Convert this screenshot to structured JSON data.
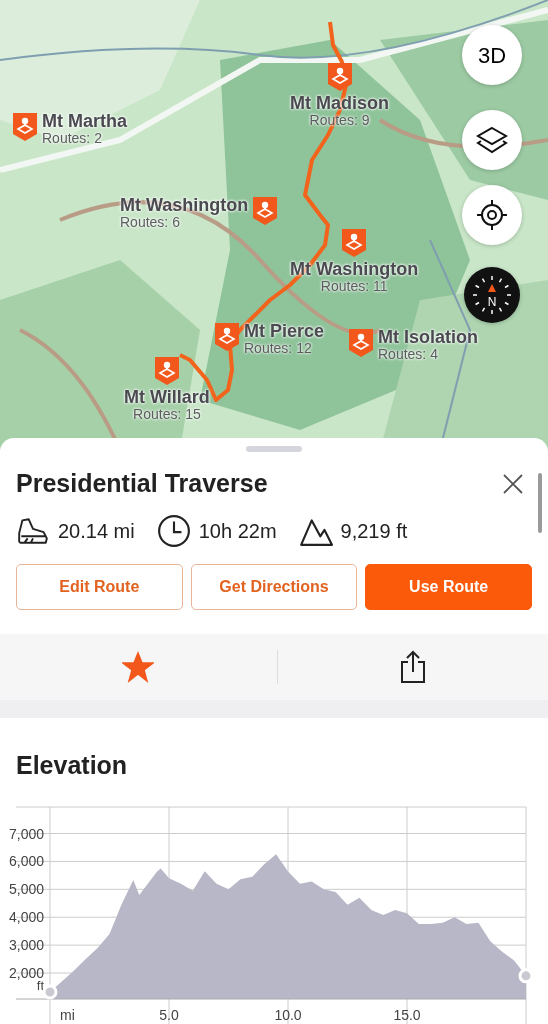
{
  "map": {
    "kind": "picture",
    "controls": [
      {
        "kind": "perspective",
        "label": "3D"
      },
      {
        "kind": "layers"
      },
      {
        "kind": "locate"
      },
      {
        "kind": "compass",
        "label": "N"
      }
    ],
    "peaks": [
      {
        "name": "Mt Martha",
        "routes": "Routes: 2"
      },
      {
        "name": "Mt Madison",
        "routes": "Routes: 9"
      },
      {
        "name": "Mt Washington",
        "routes": "Routes: 6"
      },
      {
        "name": "Mt Washington",
        "routes": "Routes: 11"
      },
      {
        "name": "Mt Pierce",
        "routes": "Routes: 12"
      },
      {
        "name": "Mt Isolation",
        "routes": "Routes: 4"
      },
      {
        "name": "Mt Willard",
        "routes": "Routes: 15"
      }
    ]
  },
  "route": {
    "title": "Presidential Traverse",
    "stats": [
      {
        "kind": "distance",
        "value": "20.14 mi"
      },
      {
        "kind": "time",
        "value": "10h 22m"
      },
      {
        "kind": "elevation",
        "value": "9,219 ft"
      }
    ],
    "buttons": [
      {
        "label": "Edit Route",
        "kind": "outline"
      },
      {
        "label": "Get Directions",
        "kind": "outline"
      },
      {
        "label": "Use Route",
        "kind": "filled"
      }
    ],
    "favorite": {
      "selected": true
    }
  },
  "elevation": {
    "chart_data": {
      "type": "area",
      "title": "Elevation",
      "xlabel": "mi",
      "ylabel": "ft",
      "x": [
        0,
        1,
        1.5,
        2,
        2.5,
        3,
        3.5,
        3.75,
        4.5,
        4.65,
        5,
        5.5,
        6,
        6.5,
        7,
        7.5,
        8,
        8.5,
        9,
        9.5,
        10,
        10.5,
        11,
        11.5,
        12,
        12.5,
        13,
        13.5,
        14,
        14.5,
        15,
        15.5,
        16,
        16.5,
        17,
        17.5,
        18,
        18.5,
        19,
        19.5,
        20
      ],
      "series": [
        {
          "color": "#b8b7c7",
          "values": [
            1320,
            2080,
            2500,
            2900,
            3400,
            4450,
            5330,
            4800,
            5640,
            5750,
            5400,
            5200,
            4950,
            5650,
            5200,
            5000,
            5360,
            5450,
            5900,
            6260,
            5640,
            5200,
            5280,
            5000,
            4900,
            4450,
            4700,
            4260,
            4080,
            4260,
            4140,
            3760,
            3760,
            3800,
            4000,
            3760,
            3800,
            3140,
            2760,
            2450,
            1900
          ]
        }
      ],
      "xlim": [
        0,
        20
      ],
      "ylim": [
        1070,
        7950
      ],
      "grid": true,
      "xticks": [
        {
          "value": 5,
          "label": "5.0"
        },
        {
          "value": 10,
          "label": "10.0"
        },
        {
          "value": 15,
          "label": "15.0"
        }
      ],
      "yticks": [
        {
          "value": 2000,
          "label": "2,000"
        },
        {
          "value": 3000,
          "label": "3,000"
        },
        {
          "value": 4000,
          "label": "4,000"
        },
        {
          "value": 5000,
          "label": "5,000"
        },
        {
          "value": 6000,
          "label": "6,000"
        },
        {
          "value": 7000,
          "label": "7,000"
        }
      ]
    }
  }
}
